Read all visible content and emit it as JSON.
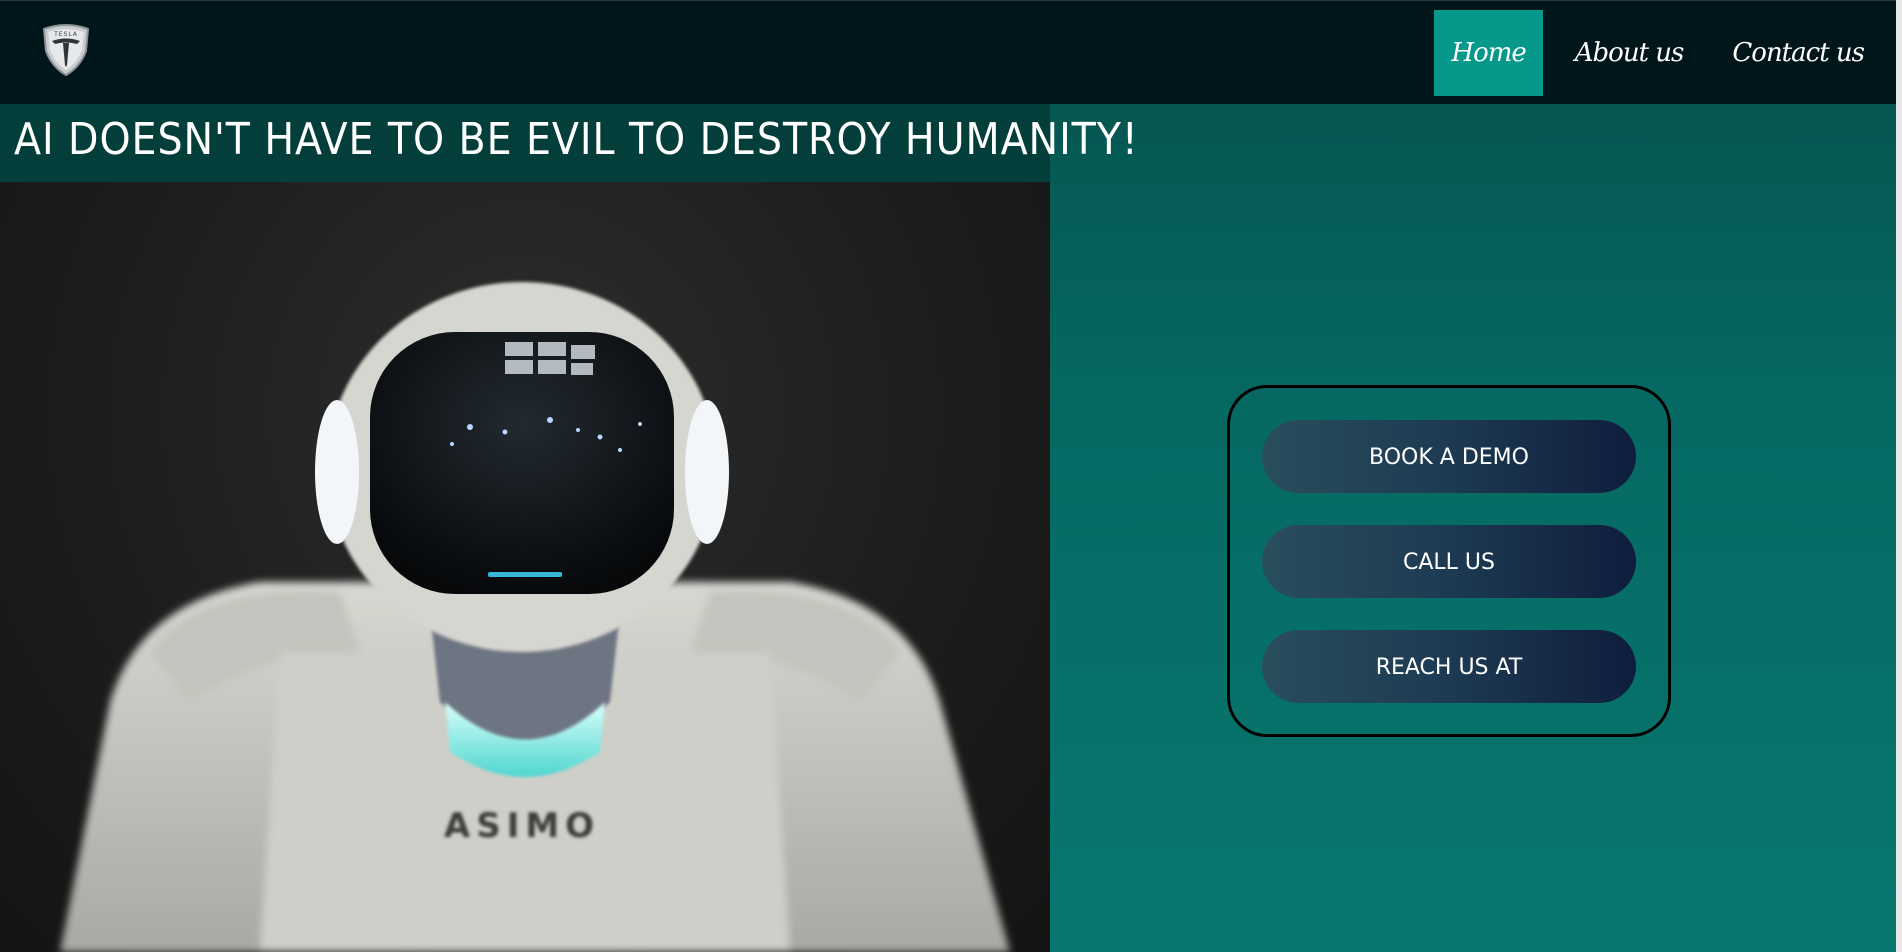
{
  "nav": {
    "logo_text": "TESLA",
    "links": [
      {
        "label": "Home",
        "active": true
      },
      {
        "label": "About us",
        "active": false
      },
      {
        "label": "Contact us",
        "active": false
      }
    ]
  },
  "headline": "AI DOESN'T HAVE TO BE EVIL TO DESTROY HUMANITY!",
  "hero": {
    "chest_text": "ASIMO"
  },
  "cta": {
    "buttons": [
      {
        "label": "BOOK A DEMO"
      },
      {
        "label": "CALL US"
      },
      {
        "label": "REACH US AT"
      }
    ]
  },
  "colors": {
    "nav_background": "#01161a",
    "active_nav": "#06988a",
    "page_teal": "#066a63",
    "button_gradient_start": "#294e5c",
    "button_gradient_end": "#0f1d3d"
  }
}
